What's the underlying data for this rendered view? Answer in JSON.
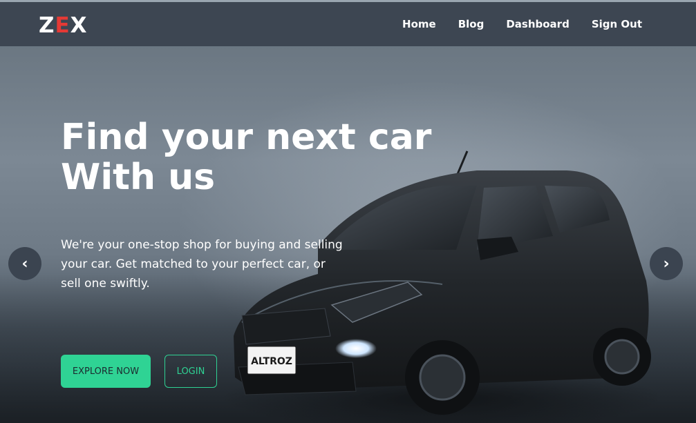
{
  "brand": {
    "prefix": "Z",
    "accent": "E",
    "suffix": "X",
    "accent_color": "#e53935"
  },
  "nav": {
    "items": [
      {
        "label": "Home"
      },
      {
        "label": "Blog"
      },
      {
        "label": "Dashboard"
      },
      {
        "label": "Sign Out"
      }
    ]
  },
  "hero": {
    "title_line1": "Find your next car",
    "title_line2": "With us",
    "description": "We're your one-stop shop for buying and selling your car. Get matched to your perfect car, or sell one swiftly.",
    "primary_button": "EXPLORE NOW",
    "secondary_button": "LOGIN",
    "accent_color": "#2fd394",
    "car_plate_text": "ALTROZ"
  },
  "carousel": {
    "prev_icon": "chevron-left-icon",
    "next_icon": "chevron-right-icon",
    "prev_glyph": "‹",
    "next_glyph": "›"
  }
}
